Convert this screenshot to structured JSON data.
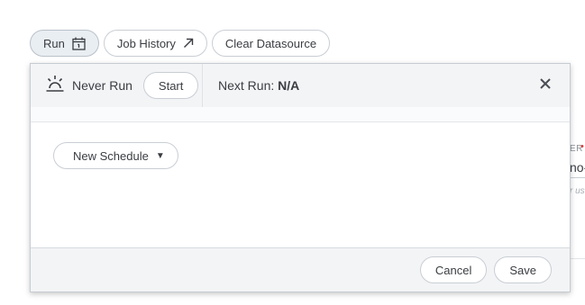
{
  "toolbar": {
    "run_label": "Run",
    "job_history_label": "Job History",
    "clear_label": "Clear Datasource"
  },
  "background": {
    "field_label_fragment": "ER",
    "required_mark": "•",
    "field_value_fragment": "no-",
    "hint_fragment": "r us"
  },
  "dialog": {
    "status_label": "Never Run",
    "start_label": "Start",
    "next_run_prefix": "Next Run:",
    "next_run_value": "N/A",
    "new_schedule_label": "New Schedule",
    "cancel_label": "Cancel",
    "save_label": "Save"
  },
  "icons": {
    "run": "calendar-icon",
    "job_history": "arrow-up-right-icon",
    "status": "sunrise-icon",
    "close": "close-icon",
    "caret": "caret-down-icon"
  }
}
